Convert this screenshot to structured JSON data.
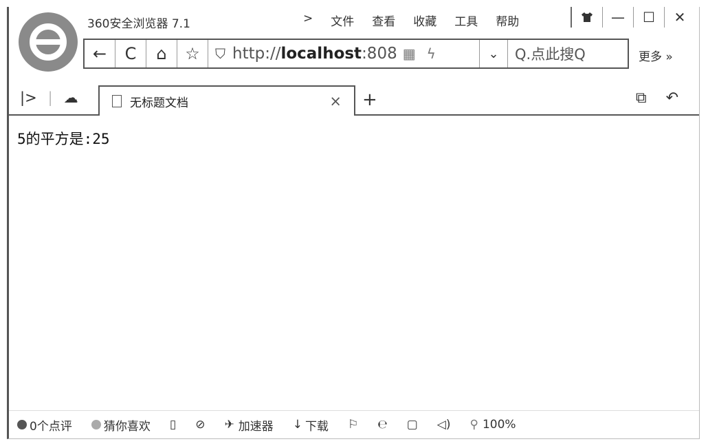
{
  "window": {
    "app_title": "360安全浏览器 7.1",
    "menu": [
      ">",
      "文件",
      "查看",
      "收藏",
      "工具",
      "帮助"
    ],
    "controls": [
      "shirt-icon",
      "minimize",
      "maximize",
      "close"
    ]
  },
  "toolbar": {
    "back": "←",
    "refresh": "C",
    "home": "⌂",
    "favorite": "☆",
    "address_prefix": "http://",
    "address_host": "localhost",
    "address_suffix": ":808",
    "search_label": "Q.点此搜Q",
    "more_label": "更多 »"
  },
  "tabs": {
    "active_title": "无标题文档",
    "close": "×",
    "new_tab": "+"
  },
  "content": {
    "text": "5的平方是:25"
  },
  "statusbar": {
    "reviews": "0个点评",
    "guess": "猜你喜欢",
    "accelerator": "加速器",
    "download": "下载",
    "zoom": "100%"
  }
}
